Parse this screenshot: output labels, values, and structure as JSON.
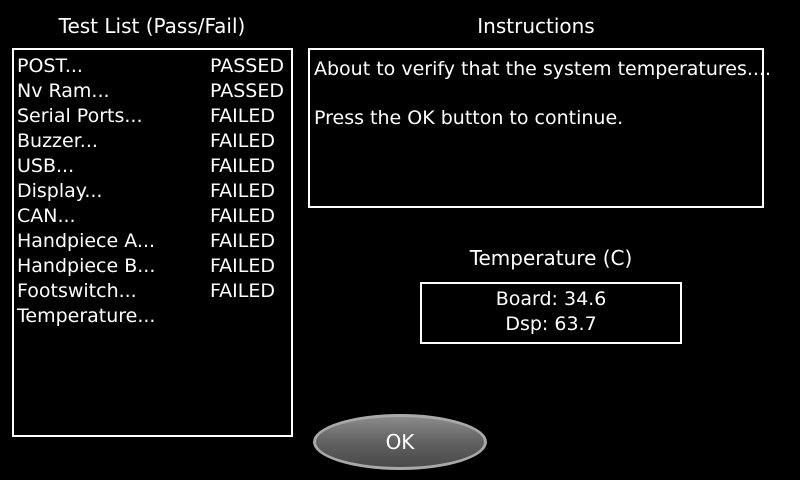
{
  "test_list": {
    "title": "Test List (Pass/Fail)",
    "items": [
      {
        "name": "POST...",
        "status": "PASSED"
      },
      {
        "name": "Nv Ram...",
        "status": "PASSED"
      },
      {
        "name": "Serial Ports...",
        "status": "FAILED"
      },
      {
        "name": "Buzzer...",
        "status": "FAILED"
      },
      {
        "name": "USB...",
        "status": "FAILED"
      },
      {
        "name": "Display...",
        "status": "FAILED"
      },
      {
        "name": "CAN...",
        "status": "FAILED"
      },
      {
        "name": "Handpiece A...",
        "status": "FAILED"
      },
      {
        "name": "Handpiece B...",
        "status": "FAILED"
      },
      {
        "name": "Footswitch...",
        "status": "FAILED"
      },
      {
        "name": "Temperature...",
        "status": ""
      }
    ]
  },
  "instructions": {
    "title": "Instructions",
    "line1": "About to verify that the system temperatures....",
    "line2": "Press the OK button to continue."
  },
  "temperature": {
    "title": "Temperature (C)",
    "board": "Board: 34.6",
    "dsp": "Dsp: 63.7"
  },
  "ok_button": {
    "label": "OK"
  },
  "colors": {
    "background": "#000000",
    "foreground": "#ffffff",
    "button": "#6b6b6b"
  }
}
